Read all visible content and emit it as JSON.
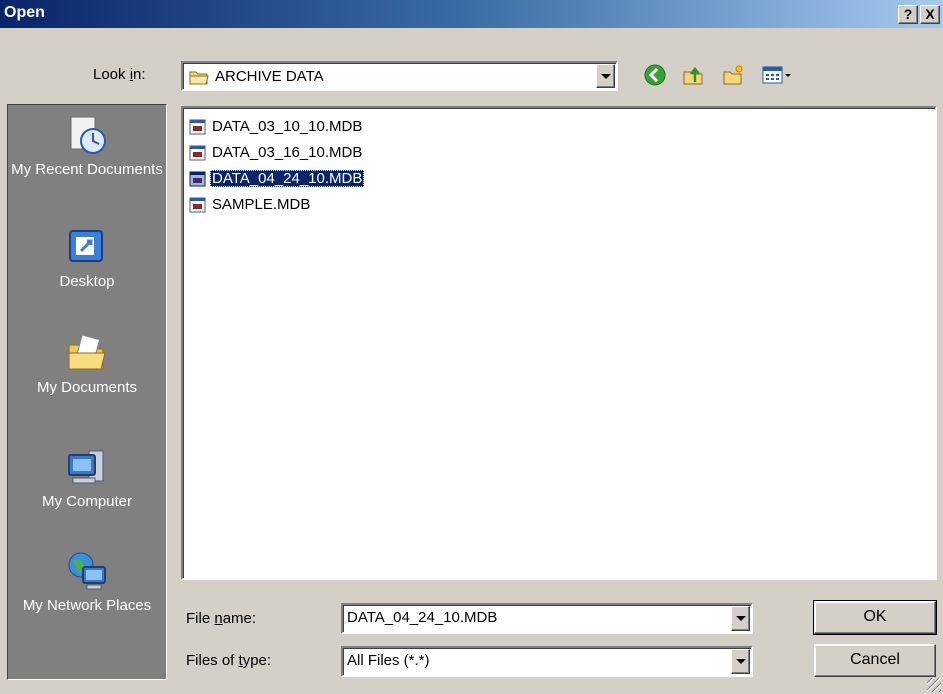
{
  "window": {
    "title": "Open",
    "help_label": "?",
    "close_label": "X"
  },
  "lookin": {
    "label_pre": "Look ",
    "label_key": "i",
    "label_post": "n:",
    "value": "ARCHIVE DATA"
  },
  "places": [
    {
      "label": "My Recent Documents",
      "icon": "recent-documents-icon"
    },
    {
      "label": "Desktop",
      "icon": "desktop-icon"
    },
    {
      "label": "My Documents",
      "icon": "my-documents-icon"
    },
    {
      "label": "My Computer",
      "icon": "my-computer-icon"
    },
    {
      "label": "My Network Places",
      "icon": "network-places-icon"
    }
  ],
  "files": [
    {
      "name": "DATA_03_10_10.MDB",
      "selected": false
    },
    {
      "name": "DATA_03_16_10.MDB",
      "selected": false
    },
    {
      "name": "DATA_04_24_10.MDB",
      "selected": true
    },
    {
      "name": "SAMPLE.MDB",
      "selected": false
    }
  ],
  "filename": {
    "label_pre": "File ",
    "label_key": "n",
    "label_post": "ame:",
    "value": "DATA_04_24_10.MDB"
  },
  "filetype": {
    "label_pre": "Files of ",
    "label_key": "t",
    "label_post": "ype:",
    "value": "All Files (*.*)"
  },
  "buttons": {
    "ok": "OK",
    "cancel": "Cancel"
  },
  "colors": {
    "title_start": "#0a246a",
    "title_end": "#a6caf0",
    "selection": "#0a246a",
    "places_bg": "#808080",
    "face": "#d4d0c8"
  }
}
